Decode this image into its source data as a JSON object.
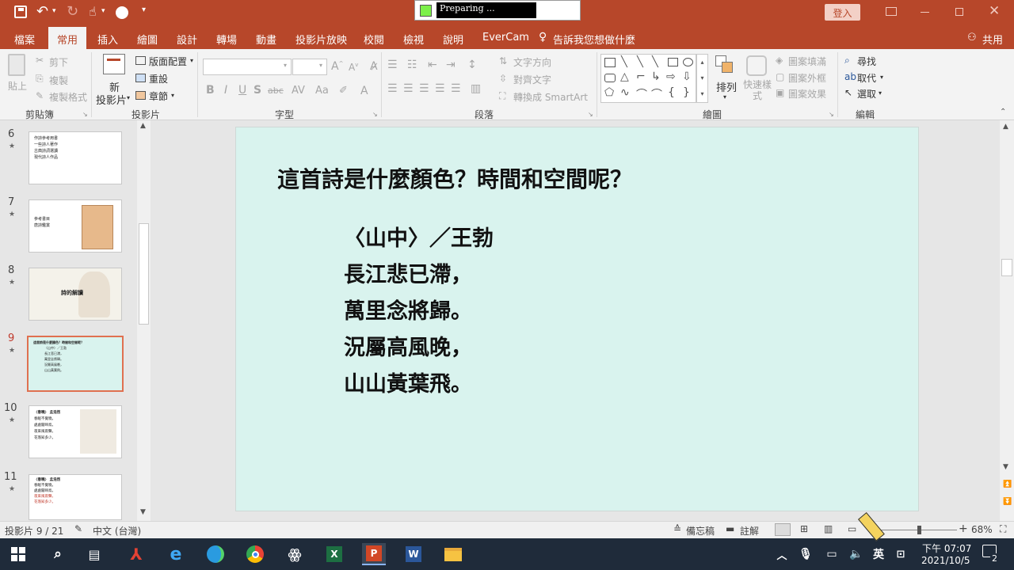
{
  "titlebar": {
    "progress_text": "Preparing ...",
    "login_label": "登入"
  },
  "ribbon_tabs": [
    "檔案",
    "常用",
    "插入",
    "繪圖",
    "設計",
    "轉場",
    "動畫",
    "投影片放映",
    "校閱",
    "檢視",
    "說明",
    "EverCam"
  ],
  "active_tab": "常用",
  "tell_me": "告訴我您想做什麼",
  "share_label": "共用",
  "clipboard": {
    "paste": "貼上",
    "cut": "剪下",
    "copy": "複製",
    "format_painter": "複製格式",
    "group": "剪貼簿"
  },
  "slides_group": {
    "new_slide_line1": "新",
    "new_slide_line2": "投影片",
    "layout": "版面配置",
    "reset": "重設",
    "section": "章節",
    "group": "投影片"
  },
  "font_group": {
    "group": "字型",
    "bold": "B",
    "italic": "I",
    "underline": "U",
    "shadow": "S",
    "strike": "abc"
  },
  "paragraph_group": {
    "text_direction": "文字方向",
    "align_text": "對齊文字",
    "smartart": "轉換成 SmartArt",
    "group": "段落"
  },
  "drawing_group": {
    "arrange": "排列",
    "quick_styles": "快速樣式",
    "fill": "圖案填滿",
    "outline": "圖案外框",
    "effects": "圖案效果",
    "group": "繪圖"
  },
  "editing_group": {
    "find": "尋找",
    "replace": "取代",
    "select": "選取",
    "group": "編輯"
  },
  "thumbnails": [
    {
      "num": "6",
      "lines": [
        "作詩參考用書",
        "一些詩人著作",
        "古典詩詞選讀",
        "現代詩人作品"
      ]
    },
    {
      "num": "7",
      "lines": [
        "參考書目",
        "唐詩鑑賞"
      ]
    },
    {
      "num": "8",
      "lines": [
        "詩的解讀"
      ]
    },
    {
      "num": "9",
      "lines": [
        "這首詩是什麼顏色？時間和空間呢？",
        "〈山中〉／王勃",
        "長江悲已滯，",
        "萬里念將歸。",
        "況屬高風晚，",
        "山山黃葉飛。"
      ]
    },
    {
      "num": "10",
      "lines": [
        "〈春曉〉 孟浩然",
        "春眠不覺曉，",
        "處處聞啼鳥，",
        "夜來風雨聲，",
        "花落知多少。"
      ]
    },
    {
      "num": "11",
      "lines": [
        "〈春曉〉 孟浩然",
        "春眠不覺曉，",
        "處處聞啼鳥，",
        "夜來風雨聲，",
        "花落知多少。"
      ]
    }
  ],
  "selected_slide": "9",
  "slide": {
    "title": "這首詩是什麼顏色？時間和空間呢？",
    "poem": [
      "〈山中〉／王勃",
      "長江悲已滯，",
      "萬里念將歸。",
      "況屬高風晚，",
      "山山黃葉飛。"
    ]
  },
  "status": {
    "slide_info": "投影片 9 / 21",
    "language": "中文 (台灣)",
    "notes": "備忘稿",
    "comments": "註解",
    "zoom": "68%",
    "zoom_fraction": 0.5
  },
  "taskbar": {
    "ime": "英",
    "time": "下午 07:07",
    "date": "2021/10/5",
    "notifications": "2"
  },
  "colors": {
    "accent": "#b7472a",
    "slide_bg": "#d9f3ee",
    "taskbar": "#1f2b3a"
  }
}
